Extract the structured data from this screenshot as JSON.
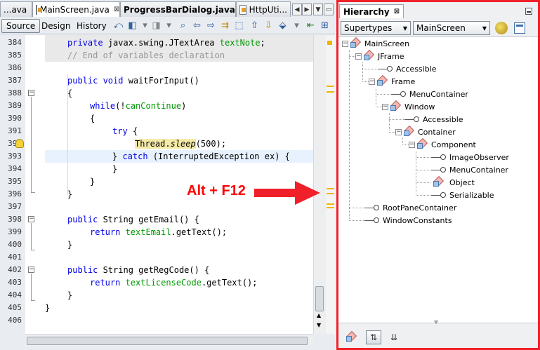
{
  "editor": {
    "tabs": [
      {
        "label": "...ava",
        "close": "⊠"
      },
      {
        "label": "MainScreen.java",
        "close": "⊠"
      },
      {
        "label": "ProgressBarDialog.java",
        "close": "⊠"
      },
      {
        "label": "HttpUti..."
      }
    ],
    "view_buttons": {
      "source": "Source",
      "design": "Design",
      "history": "History"
    },
    "line_numbers": [
      "384",
      "385",
      "386",
      "387",
      "388",
      "389",
      "390",
      "391",
      "392",
      "393",
      "394",
      "395",
      "396",
      "397",
      "398",
      "399",
      "400",
      "401",
      "402",
      "403",
      "404",
      "405",
      "406"
    ],
    "code": {
      "l384_kw": "private",
      "l384_pl": " javax.swing.JTextArea ",
      "l384_fld": "textNote",
      "l384_end": ";",
      "l385": "// End of variables declaration",
      "l387_kw": "public",
      "l387_kw2": " void",
      "l387_pl": " waitForInput()",
      "l388": "{",
      "l389_kw": "while",
      "l389_pl1": "(!",
      "l389_fld": "canContinue",
      "l389_pl2": ")",
      "l390": "{",
      "l391_kw": "try",
      "l391_pl": " {",
      "l392_pl1": "Thread.",
      "l392_it": "sleep",
      "l392_pl2": "(500);",
      "l393_pl1": "} ",
      "l393_kw": "catch",
      "l393_pl2": " (InterruptedException ex) {",
      "l394": "}",
      "l395": "}",
      "l396": "}",
      "l398_kw": "public",
      "l398_pl": " String getEmail() {",
      "l399_kw": "return",
      "l399_fld": " textEmail",
      "l399_pl": ".getText();",
      "l400": "}",
      "l402_kw": "public",
      "l402_pl": " String getRegCode() {",
      "l403_kw": "return",
      "l403_fld": " textLicenseCode",
      "l403_pl": ".getText();",
      "l404": "}",
      "l405": "}"
    }
  },
  "annotation": {
    "label": "Alt + F12",
    "color": "#ff0000"
  },
  "hierarchy": {
    "title": "Hierarchy",
    "close": "⊠",
    "mode_select": "Supertypes",
    "class_select": "MainScreen",
    "tree": [
      {
        "label": "MainScreen",
        "kind": "class"
      },
      {
        "label": "JFrame",
        "kind": "class"
      },
      {
        "label": "Accessible",
        "kind": "interface"
      },
      {
        "label": "Frame",
        "kind": "class"
      },
      {
        "label": "MenuContainer",
        "kind": "interface"
      },
      {
        "label": "Window",
        "kind": "class"
      },
      {
        "label": "Accessible",
        "kind": "interface"
      },
      {
        "label": "Container",
        "kind": "class"
      },
      {
        "label": "Component",
        "kind": "class"
      },
      {
        "label": "ImageObserver",
        "kind": "interface"
      },
      {
        "label": "MenuContainer",
        "kind": "interface"
      },
      {
        "label": "Object",
        "kind": "class"
      },
      {
        "label": "Serializable",
        "kind": "interface"
      },
      {
        "label": "RootPaneContainer",
        "kind": "interface"
      },
      {
        "label": "WindowConstants",
        "kind": "interface"
      }
    ]
  },
  "colors": {
    "highlight_border": "#f0202a",
    "keyword": "#0000e6",
    "field": "#009900",
    "comment": "#969696"
  }
}
